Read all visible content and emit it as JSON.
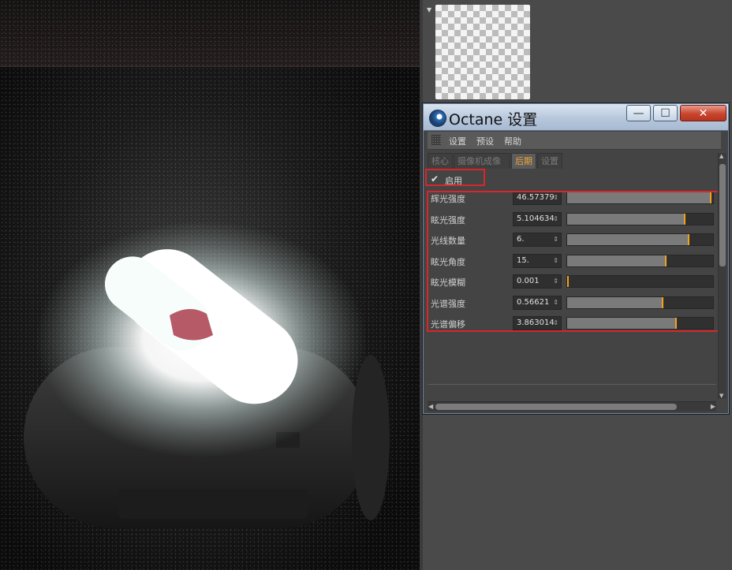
{
  "window": {
    "title": "Octane 设置",
    "min_glyph": "—",
    "max_glyph": "☐",
    "close_glyph": "✕"
  },
  "menu": {
    "items": [
      "设置",
      "预设",
      "帮助"
    ]
  },
  "tabs": {
    "items": [
      "核心",
      "摄像机成像",
      "后期",
      "设置"
    ],
    "active": "后期"
  },
  "enable": {
    "checked": true,
    "check_glyph": "✔",
    "label": "启用"
  },
  "params": [
    {
      "label": "辉光强度",
      "value": "46.57379",
      "level": 0.99
    },
    {
      "label": "眩光强度",
      "value": "5.104634",
      "level": 0.81
    },
    {
      "label": "光线数量",
      "value": "6.",
      "level": 0.84
    },
    {
      "label": "眩光角度",
      "value": "15.",
      "level": 0.68
    },
    {
      "label": "眩光模糊",
      "value": "0.001",
      "level": 0.0
    },
    {
      "label": "光谱强度",
      "value": "0.56621",
      "level": 0.66
    },
    {
      "label": "光谱偏移",
      "value": "3.863014",
      "level": 0.75
    }
  ],
  "colors": {
    "accent": "#f2a11d",
    "highlight_box": "#d8262b",
    "active_tab_text": "#f0a53a"
  },
  "icons": {
    "app": "octane-logo-icon",
    "menu_grip": "grip-icon",
    "spinner": "spinner-arrows-icon"
  }
}
